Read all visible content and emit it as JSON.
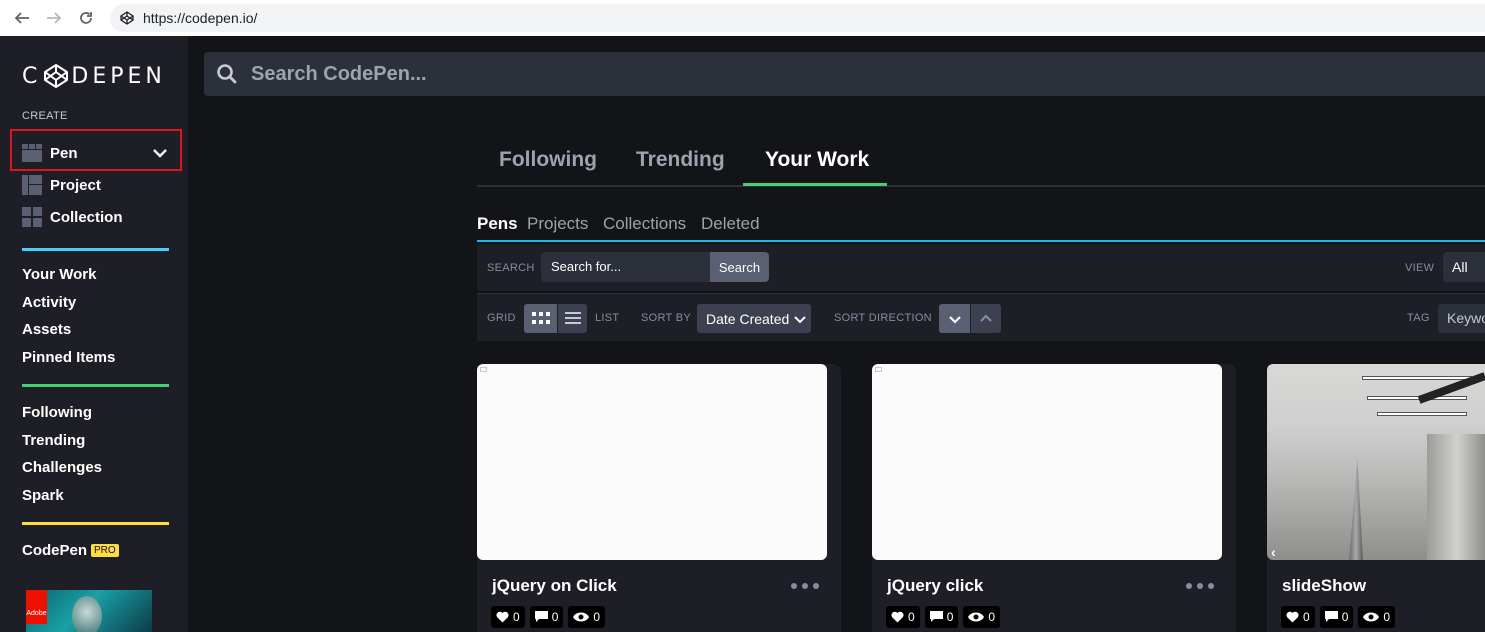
{
  "browser": {
    "url": "https://codepen.io/"
  },
  "sidebar": {
    "logo": "C◇DEPEN",
    "create_label": "CREATE",
    "create_items": [
      {
        "label": "Pen",
        "icon": "pen-layout-icon"
      },
      {
        "label": "Project",
        "icon": "project-layout-icon"
      },
      {
        "label": "Collection",
        "icon": "collection-grid-icon"
      }
    ],
    "section1": [
      "Your Work",
      "Activity",
      "Assets",
      "Pinned Items"
    ],
    "section2": [
      "Following",
      "Trending",
      "Challenges",
      "Spark"
    ],
    "pro_link": "CodePen",
    "pro_badge": "PRO",
    "ad_brand": "Adobe",
    "colors": {
      "divider_blue": "#47cfff",
      "divider_green": "#47cf73",
      "divider_yellow": "#ffdd40",
      "highlight": "#e0141f"
    }
  },
  "top_search": {
    "placeholder": "Search CodePen..."
  },
  "main_tabs": [
    {
      "label": "Following",
      "active": false
    },
    {
      "label": "Trending",
      "active": false
    },
    {
      "label": "Your Work",
      "active": true
    }
  ],
  "sub_tabs": [
    {
      "label": "Pens",
      "active": true
    },
    {
      "label": "Projects",
      "active": false
    },
    {
      "label": "Collections",
      "active": false
    },
    {
      "label": "Deleted",
      "active": false
    }
  ],
  "filters": {
    "search_label": "SEARCH",
    "search_placeholder": "Search for...",
    "search_button": "Search",
    "view_label": "VIEW",
    "view_value": "All",
    "grid_label": "GRID",
    "list_label": "LIST",
    "sort_by_label": "SORT BY",
    "sort_by_value": "Date Created",
    "sort_direction_label": "SORT DIRECTION",
    "tag_label": "TAG",
    "tag_placeholder": "Keywo"
  },
  "cards": [
    {
      "title": "jQuery on Click",
      "likes": "0",
      "comments": "0",
      "views": "0",
      "preview": "blank"
    },
    {
      "title": "jQuery click",
      "likes": "0",
      "comments": "0",
      "views": "0",
      "preview": "blank"
    },
    {
      "title": "slideShow",
      "likes": "0",
      "comments": "0",
      "views": "0",
      "preview": "photo"
    }
  ]
}
